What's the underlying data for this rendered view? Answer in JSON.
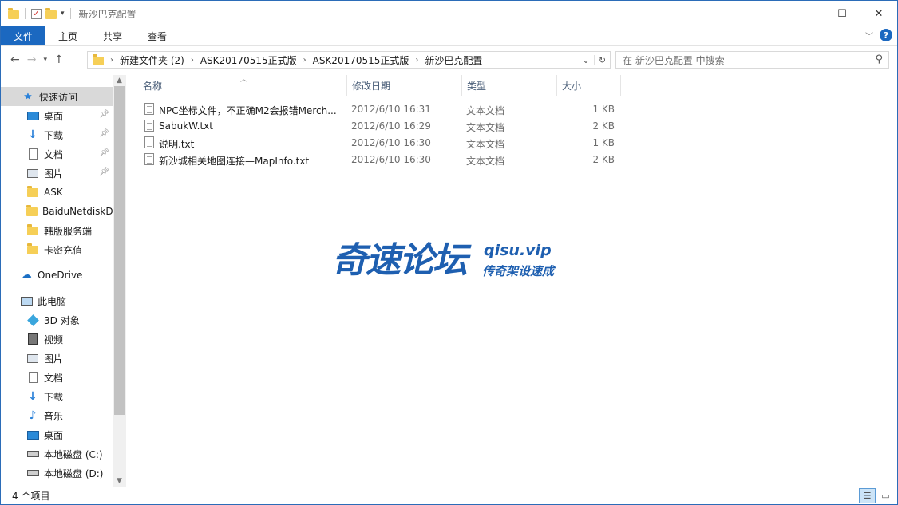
{
  "window": {
    "title": "新沙巴克配置",
    "controls": {
      "minimize": "—",
      "maximize": "☐",
      "close": "✕"
    }
  },
  "ribbon": {
    "tabs": [
      "文件",
      "主页",
      "共享",
      "查看"
    ]
  },
  "nav": {
    "breadcrumb": [
      "新建文件夹 (2)",
      "ASK20170515正式版",
      "ASK20170515正式版",
      "新沙巴克配置"
    ],
    "search_placeholder": "在 新沙巴克配置 中搜索"
  },
  "sidebar": {
    "items": [
      {
        "label": "快速访问",
        "icon": "star-icon"
      },
      {
        "label": "桌面",
        "icon": "desktop-icon",
        "pinned": true
      },
      {
        "label": "下载",
        "icon": "download-icon",
        "pinned": true
      },
      {
        "label": "文档",
        "icon": "document-icon",
        "pinned": true
      },
      {
        "label": "图片",
        "icon": "pictures-icon",
        "pinned": true
      },
      {
        "label": "ASK",
        "icon": "folder-icon"
      },
      {
        "label": "BaiduNetdiskD",
        "icon": "folder-icon"
      },
      {
        "label": "韩版服务端",
        "icon": "folder-icon"
      },
      {
        "label": "卡密充值",
        "icon": "folder-icon"
      },
      {
        "label": "OneDrive",
        "icon": "cloud-icon"
      },
      {
        "label": "此电脑",
        "icon": "computer-icon"
      },
      {
        "label": "3D 对象",
        "icon": "3d-objects-icon"
      },
      {
        "label": "视频",
        "icon": "video-icon"
      },
      {
        "label": "图片",
        "icon": "pictures-icon"
      },
      {
        "label": "文档",
        "icon": "document-icon"
      },
      {
        "label": "下载",
        "icon": "download-icon"
      },
      {
        "label": "音乐",
        "icon": "music-icon"
      },
      {
        "label": "桌面",
        "icon": "desktop-icon"
      },
      {
        "label": "本地磁盘 (C:)",
        "icon": "drive-icon"
      },
      {
        "label": "本地磁盘 (D:)",
        "icon": "drive-icon"
      }
    ]
  },
  "columns": {
    "name": "名称",
    "date": "修改日期",
    "type": "类型",
    "size": "大小"
  },
  "files": [
    {
      "name": "NPC坐标文件，不正确M2会报错Merch...",
      "date": "2012/6/10 16:31",
      "type": "文本文档",
      "size": "1 KB"
    },
    {
      "name": "SabukW.txt",
      "date": "2012/6/10 16:29",
      "type": "文本文档",
      "size": "2 KB"
    },
    {
      "name": "说明.txt",
      "date": "2012/6/10 16:30",
      "type": "文本文档",
      "size": "1 KB"
    },
    {
      "name": "新沙城相关地图连接—MapInfo.txt",
      "date": "2012/6/10 16:30",
      "type": "文本文档",
      "size": "2 KB"
    }
  ],
  "watermark": {
    "name": "奇速论坛",
    "url": "qisu.vip",
    "slogan": "传奇架设速成"
  },
  "status": {
    "count": "4 个项目"
  },
  "colors": {
    "accent": "#1b68c0",
    "watermark": "#1e5fb0"
  }
}
